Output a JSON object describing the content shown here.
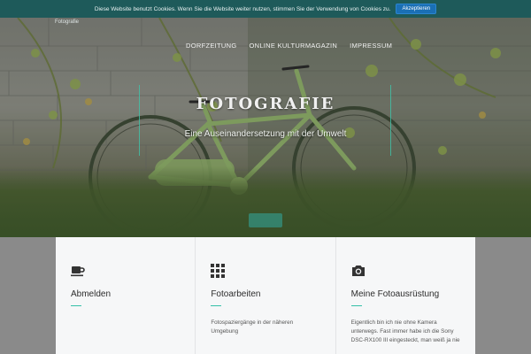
{
  "cookie": {
    "message": "Diese Website benutzt Cookies. Wenn Sie die Website weiter nutzen, stimmen Sie der Verwendung von Cookies zu.",
    "accept_label": "Akzeptieren"
  },
  "header": {
    "logo_text": "Fotografie",
    "nav": [
      {
        "label": "DORFZEITUNG"
      },
      {
        "label": "ONLINE KULTURMAGAZIN"
      },
      {
        "label": "IMPRESSUM"
      }
    ]
  },
  "hero": {
    "title": "FOTOGRAFIE",
    "subtitle": "Eine Auseinandersetzung mit der Umwelt"
  },
  "features": [
    {
      "icon": "coffee-cup-icon",
      "title": "Abmelden",
      "text": ""
    },
    {
      "icon": "grid-icon",
      "title": "Fotoarbeiten",
      "text": "Fotospaziergänge in der näheren Umgebung"
    },
    {
      "icon": "camera-icon",
      "title": "Meine Fotoausrüstung",
      "text": "Eigentlich bin ich nie ohne Kamera unterwegs.    Fast immer habe ich die Sony DSC-RX100 III eingesteckt, man weiß ja nie"
    }
  ],
  "colors": {
    "accent": "#35c0a8",
    "cookie_bar": "#1e5a5a",
    "accept_button": "#1a6fb5"
  }
}
